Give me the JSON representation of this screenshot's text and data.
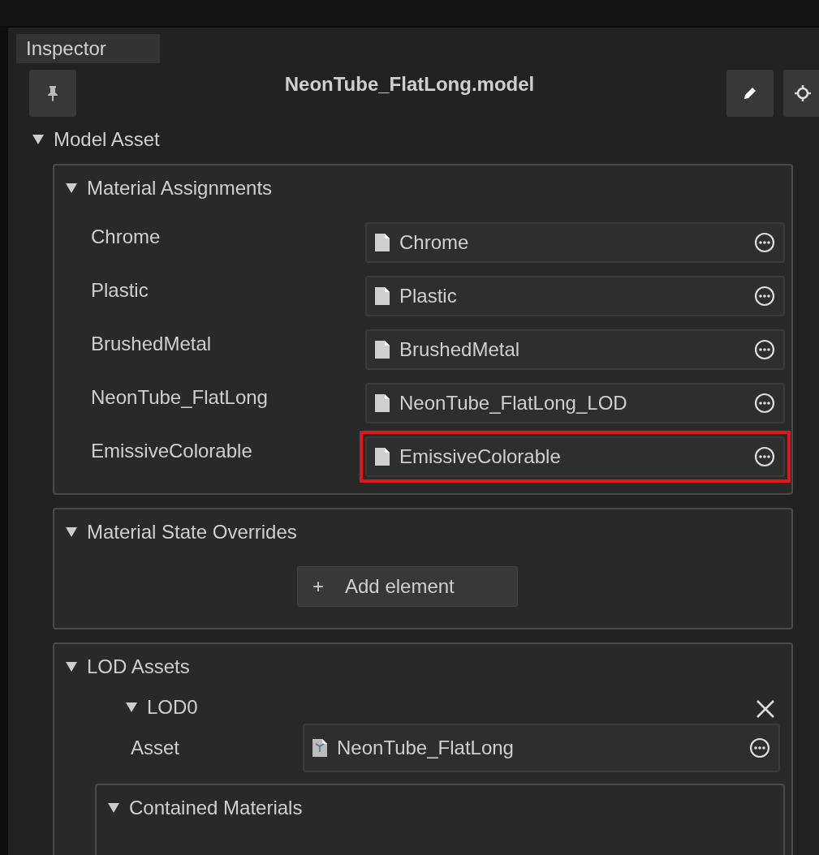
{
  "tab": {
    "label": "Inspector",
    "selected": true
  },
  "header": {
    "title": "NeonTube_FlatLong.model"
  },
  "model_asset": {
    "label": "Model Asset",
    "expanded": true,
    "material_assignments": {
      "label": "Material Assignments",
      "expanded": true,
      "rows": [
        {
          "name": "Chrome",
          "value": "Chrome",
          "highlighted": false
        },
        {
          "name": "Plastic",
          "value": "Plastic",
          "highlighted": false
        },
        {
          "name": "BrushedMetal",
          "value": "BrushedMetal",
          "highlighted": false
        },
        {
          "name": "NeonTube_FlatLong",
          "value": "NeonTube_FlatLong_LOD",
          "highlighted": false
        },
        {
          "name": "EmissiveColorable",
          "value": "EmissiveColorable",
          "highlighted": true
        }
      ]
    },
    "material_state_overrides": {
      "label": "Material State Overrides",
      "expanded": true,
      "add_button": {
        "icon": "+",
        "label": "Add element"
      }
    },
    "lod_assets": {
      "label": "LOD Assets",
      "expanded": true,
      "lods": [
        {
          "label": "LOD0",
          "expanded": true,
          "asset": {
            "label": "Asset",
            "value": "NeonTube_FlatLong"
          },
          "contained_materials": {
            "label": "Contained Materials",
            "expanded": true
          }
        }
      ]
    }
  }
}
